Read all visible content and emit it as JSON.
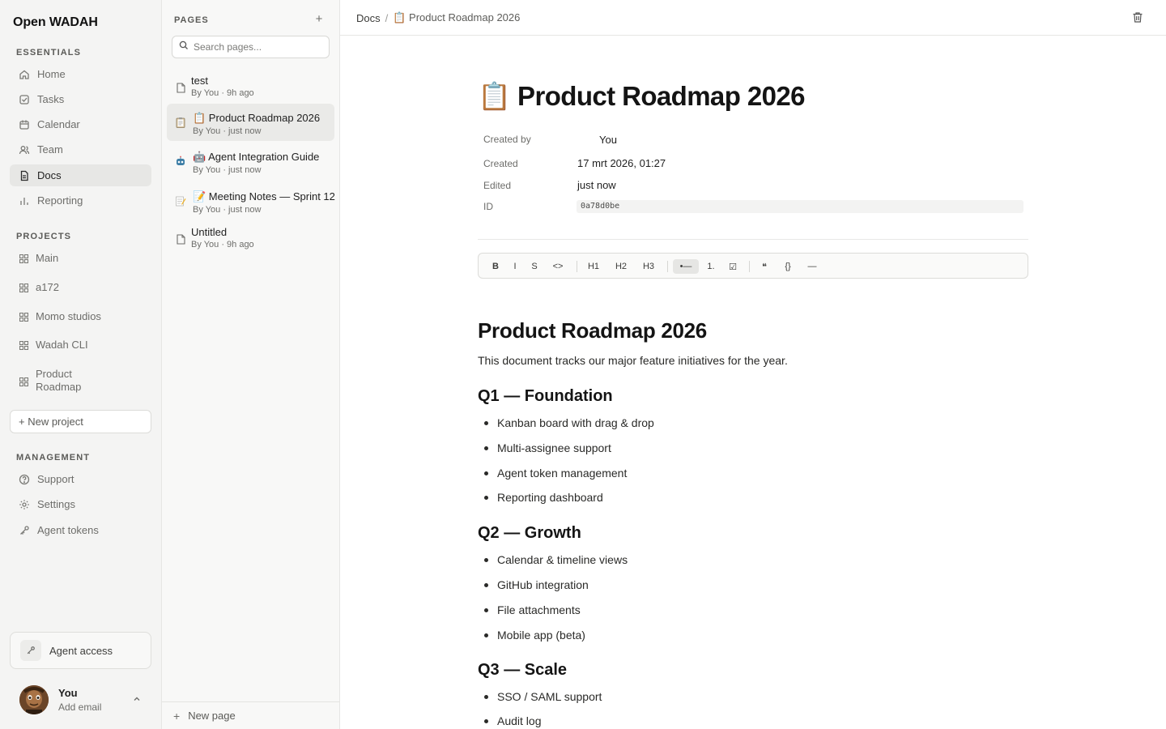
{
  "app": {
    "brand": "Open WADAH"
  },
  "sidebar": {
    "essentials_label": "ESSENTIALS",
    "essentials": [
      {
        "label": "Home",
        "icon": "home-icon"
      },
      {
        "label": "Tasks",
        "icon": "checkbox-icon"
      },
      {
        "label": "Calendar",
        "icon": "calendar-icon"
      },
      {
        "label": "Team",
        "icon": "users-icon"
      },
      {
        "label": "Docs",
        "icon": "document-icon",
        "active": true
      },
      {
        "label": "Reporting",
        "icon": "bar-chart-icon"
      }
    ],
    "projects_label": "PROJECTS",
    "projects": [
      {
        "label": "Main"
      },
      {
        "label": "a172"
      },
      {
        "label": "Momo studios"
      },
      {
        "label": "Wadah CLI"
      },
      {
        "label": "Product Roadmap"
      }
    ],
    "new_project": "+ New project",
    "management_label": "MANAGEMENT",
    "management": [
      {
        "label": "Support",
        "icon": "help-circle-icon"
      },
      {
        "label": "Settings",
        "icon": "gear-icon"
      },
      {
        "label": "Agent tokens",
        "icon": "key-icon"
      }
    ],
    "agent_access": "Agent access",
    "user": {
      "name": "You",
      "email": "Add email"
    }
  },
  "pages_panel": {
    "title": "PAGES",
    "search_placeholder": "Search pages...",
    "pages": [
      {
        "title": "test",
        "meta": "By You · 9h ago",
        "icon": "file-icon"
      },
      {
        "title": "📋 Product Roadmap 2026",
        "meta": "By You · just now",
        "icon": "clipboard-icon",
        "active": true
      },
      {
        "title": "🤖 Agent Integration Guide",
        "meta": "By You · just now",
        "icon": "robot-icon"
      },
      {
        "title": "📝 Meeting Notes — Sprint 12",
        "meta": "By You · just now",
        "icon": "memo-icon"
      },
      {
        "title": "Untitled",
        "meta": "By You · 9h ago",
        "icon": "file-icon"
      }
    ],
    "new_page": "New page"
  },
  "topbar": {
    "crumb_root": "Docs",
    "crumb_sep": "/",
    "crumb_current": "📋 Product Roadmap 2026"
  },
  "doc": {
    "title": "📋 Product Roadmap 2026",
    "props": {
      "created_by_label": "Created by",
      "created_by_value": "You",
      "created_label": "Created",
      "created_value": "17 mrt 2026, 01:27",
      "edited_label": "Edited",
      "edited_value": "just now",
      "id_label": "ID",
      "id_value": "0a78d0be"
    },
    "toolbar": {
      "bold": "B",
      "italic": "I",
      "strike": "S",
      "code": "<>",
      "h1": "H1",
      "h2": "H2",
      "h3": "H3",
      "bullet": "•—",
      "ordered": "1.",
      "todo": "☑",
      "quote": "❝",
      "codeblock": "{}",
      "rule": "—"
    },
    "heading": "Product Roadmap 2026",
    "intro": "This document tracks our major feature initiatives for the year.",
    "sections": [
      {
        "title": "Q1 — Foundation",
        "items": [
          "Kanban board with drag & drop",
          "Multi-assignee support",
          "Agent token management",
          "Reporting dashboard"
        ]
      },
      {
        "title": "Q2 — Growth",
        "items": [
          "Calendar & timeline views",
          "GitHub integration",
          "File attachments",
          "Mobile app (beta)"
        ]
      },
      {
        "title": "Q3 — Scale",
        "items": [
          "SSO / SAML support",
          "Audit log"
        ]
      }
    ]
  }
}
